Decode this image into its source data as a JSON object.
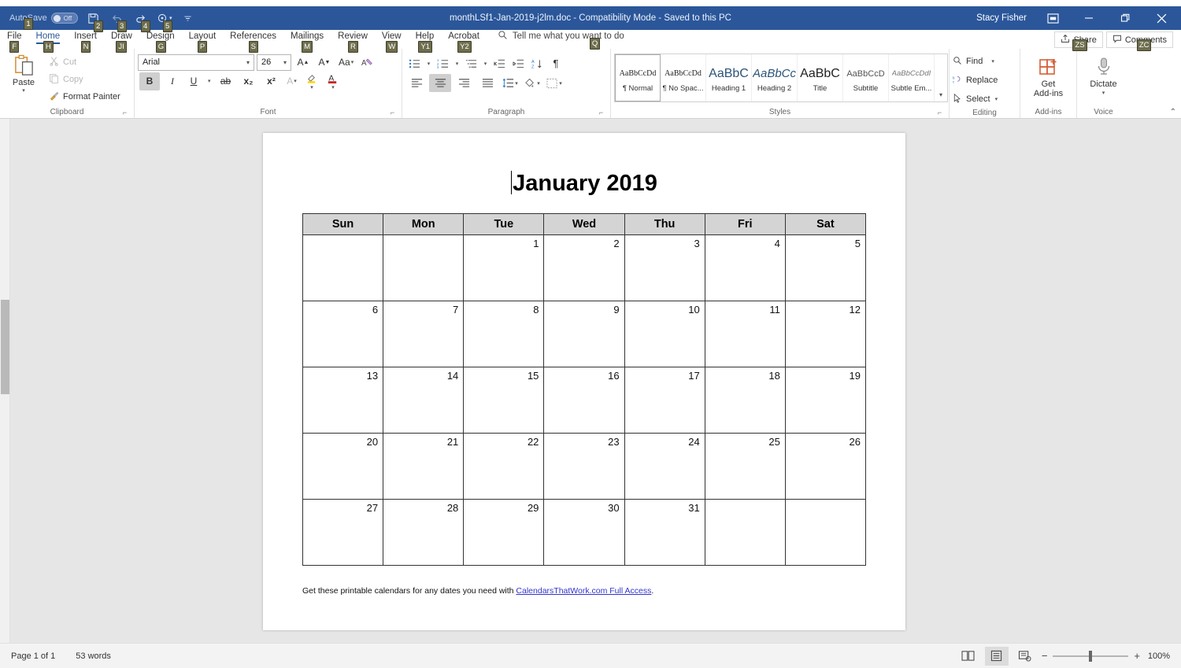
{
  "titlebar": {
    "autosave_label": "AutoSave",
    "autosave_state": "Off",
    "document_title": "monthLSf1-Jan-2019-j2lm.doc  -  Compatibility Mode  -  Saved to this PC",
    "user_name": "Stacy Fisher",
    "keytips": {
      "autosave": "1",
      "save": "2",
      "undo": "3",
      "redo": "4",
      "customize": "5"
    }
  },
  "tabs": [
    {
      "label": "File",
      "keytip": "F",
      "active": false
    },
    {
      "label": "Home",
      "keytip": "H",
      "active": true
    },
    {
      "label": "Insert",
      "keytip": "N",
      "active": false
    },
    {
      "label": "Draw",
      "keytip": "JI",
      "active": false
    },
    {
      "label": "Design",
      "keytip": "G",
      "active": false
    },
    {
      "label": "Layout",
      "keytip": "P",
      "active": false
    },
    {
      "label": "References",
      "keytip": "S",
      "active": false
    },
    {
      "label": "Mailings",
      "keytip": "M",
      "active": false
    },
    {
      "label": "Review",
      "keytip": "R",
      "active": false
    },
    {
      "label": "View",
      "keytip": "W",
      "active": false
    },
    {
      "label": "Help",
      "keytip": "Y1",
      "active": false
    },
    {
      "label": "Acrobat",
      "keytip": "Y2",
      "active": false
    }
  ],
  "tellme": {
    "placeholder": "Tell me what you want to do",
    "keytip": "Q"
  },
  "ribbon_right": [
    {
      "label": "Share",
      "keytip": "ZS"
    },
    {
      "label": "Comments",
      "keytip": "ZC"
    }
  ],
  "clipboard": {
    "group_label": "Clipboard",
    "paste_label": "Paste",
    "cut_label": "Cut",
    "copy_label": "Copy",
    "format_painter_label": "Format Painter"
  },
  "font": {
    "group_label": "Font",
    "font_name": "Arial",
    "font_size": "26",
    "bold_active": true,
    "bold": "B",
    "italic": "I",
    "underline": "U",
    "strikethrough": "ab",
    "subscript": "x₂",
    "superscript": "x²"
  },
  "paragraph": {
    "group_label": "Paragraph",
    "active_alignment": "center"
  },
  "styles": {
    "group_label": "Styles",
    "items": [
      {
        "preview": "AaBbCcDd",
        "name": "¶ Normal",
        "selected": true
      },
      {
        "preview": "AaBbCcDd",
        "name": "¶ No Spac...",
        "selected": false
      },
      {
        "preview": "AaBbC",
        "name": "Heading 1",
        "selected": false
      },
      {
        "preview": "AaBbCc",
        "name": "Heading 2",
        "selected": false
      },
      {
        "preview": "AaBbC",
        "name": "Title",
        "selected": false
      },
      {
        "preview": "AaBbCcD",
        "name": "Subtitle",
        "selected": false
      },
      {
        "preview": "AaBbCcDdI",
        "name": "Subtle Em...",
        "selected": false
      }
    ]
  },
  "editing": {
    "group_label": "Editing",
    "find_label": "Find",
    "replace_label": "Replace",
    "select_label": "Select"
  },
  "addins": {
    "group_label": "Add-ins",
    "button_label_line1": "Get",
    "button_label_line2": "Add-ins"
  },
  "voice": {
    "group_label": "Voice",
    "button_label": "Dictate"
  },
  "document": {
    "calendar_title": "January 2019",
    "day_headers": [
      "Sun",
      "Mon",
      "Tue",
      "Wed",
      "Thu",
      "Fri",
      "Sat"
    ],
    "weeks": [
      [
        "",
        "",
        "1",
        "2",
        "3",
        "4",
        "5"
      ],
      [
        "6",
        "7",
        "8",
        "9",
        "10",
        "11",
        "12"
      ],
      [
        "13",
        "14",
        "15",
        "16",
        "17",
        "18",
        "19"
      ],
      [
        "20",
        "21",
        "22",
        "23",
        "24",
        "25",
        "26"
      ],
      [
        "27",
        "28",
        "29",
        "30",
        "31",
        "",
        ""
      ]
    ],
    "footnote_prefix": "Get these printable calendars for any dates you need with ",
    "footnote_link": "CalendarsThatWork.com Full Access",
    "footnote_suffix": "."
  },
  "statusbar": {
    "page_info": "Page 1 of 1",
    "word_count": "53 words",
    "zoom_level": "100%",
    "zoom_out": "−",
    "zoom_in": "+"
  },
  "colors": {
    "word_blue": "#2b579a",
    "keytip_bg": "#6e6e4e",
    "header_grey": "#d4d4d4",
    "link_blue": "#3333cc"
  }
}
